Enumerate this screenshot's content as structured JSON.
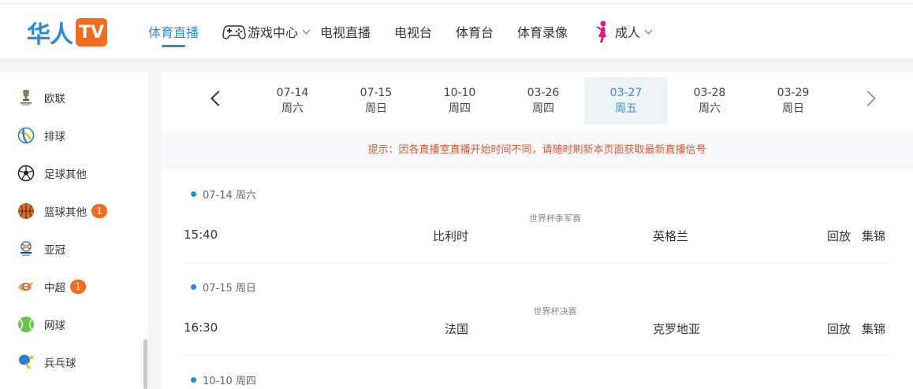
{
  "logo": {
    "text": "华人",
    "badge": "TV"
  },
  "nav": [
    {
      "label": "体育直播",
      "active": true
    },
    {
      "label": "游戏中心",
      "icon": "gamepad-icon",
      "dropdown": true
    },
    {
      "label": "电视直播"
    },
    {
      "label": "电视台"
    },
    {
      "label": "体育台"
    },
    {
      "label": "体育录像"
    },
    {
      "label": "成人",
      "icon": "adult-figure-icon",
      "dropdown": true
    }
  ],
  "sidebar": {
    "items": [
      {
        "label": "欧联",
        "icon": "europa-league-icon"
      },
      {
        "label": "排球",
        "icon": "volleyball-icon"
      },
      {
        "label": "足球其他",
        "icon": "soccer-ball-icon"
      },
      {
        "label": "篮球其他",
        "icon": "basketball-icon",
        "badge": "1"
      },
      {
        "label": "亚冠",
        "icon": "afc-champions-league-icon"
      },
      {
        "label": "中超",
        "icon": "csl-icon",
        "badge": "1"
      },
      {
        "label": "网球",
        "icon": "tennis-ball-icon"
      },
      {
        "label": "兵乓球",
        "icon": "ping-pong-icon"
      }
    ]
  },
  "dates": [
    {
      "date": "07-14",
      "weekday": "周六"
    },
    {
      "date": "07-15",
      "weekday": "周日"
    },
    {
      "date": "10-10",
      "weekday": "周四"
    },
    {
      "date": "03-26",
      "weekday": "周四"
    },
    {
      "date": "03-27",
      "weekday": "周五",
      "active": true
    },
    {
      "date": "03-28",
      "weekday": "周六"
    },
    {
      "date": "03-29",
      "weekday": "周日"
    }
  ],
  "notice": "提示：因各直播室直播开始时间不同，请随时刷新本页面获取最新直播信号",
  "sections": [
    {
      "date_label": "07-14 周六",
      "match": {
        "time": "15:40",
        "league": "世界杯季军赛",
        "home": "比利时",
        "away": "英格兰",
        "replay": "回放",
        "highlights": "集锦"
      }
    },
    {
      "date_label": "07-15 周日",
      "match": {
        "time": "16:30",
        "league": "世界杯决赛",
        "home": "法国",
        "away": "克罗地亚",
        "replay": "回放",
        "highlights": "集锦"
      }
    },
    {
      "date_label": "10-10 周四"
    }
  ],
  "colors": {
    "brand_blue": "#2a8bd8",
    "accent_orange": "#f36b21",
    "notice_red": "#e25a34"
  }
}
